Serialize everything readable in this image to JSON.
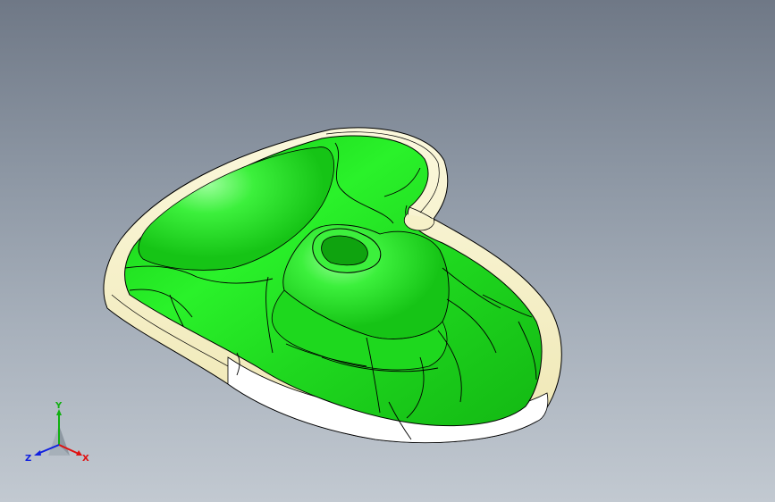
{
  "viewport": {
    "background_top": "#6f7886",
    "background_bottom": "#c2c9d1"
  },
  "model": {
    "surface_color": "#22e522",
    "flange_color": "#f6f1c8",
    "edge_color": "#000000"
  },
  "triad": {
    "x_label": "X",
    "y_label": "Y",
    "z_label": "Z",
    "x_color": "#e01010",
    "y_color": "#10b010",
    "z_color": "#1020e0"
  }
}
